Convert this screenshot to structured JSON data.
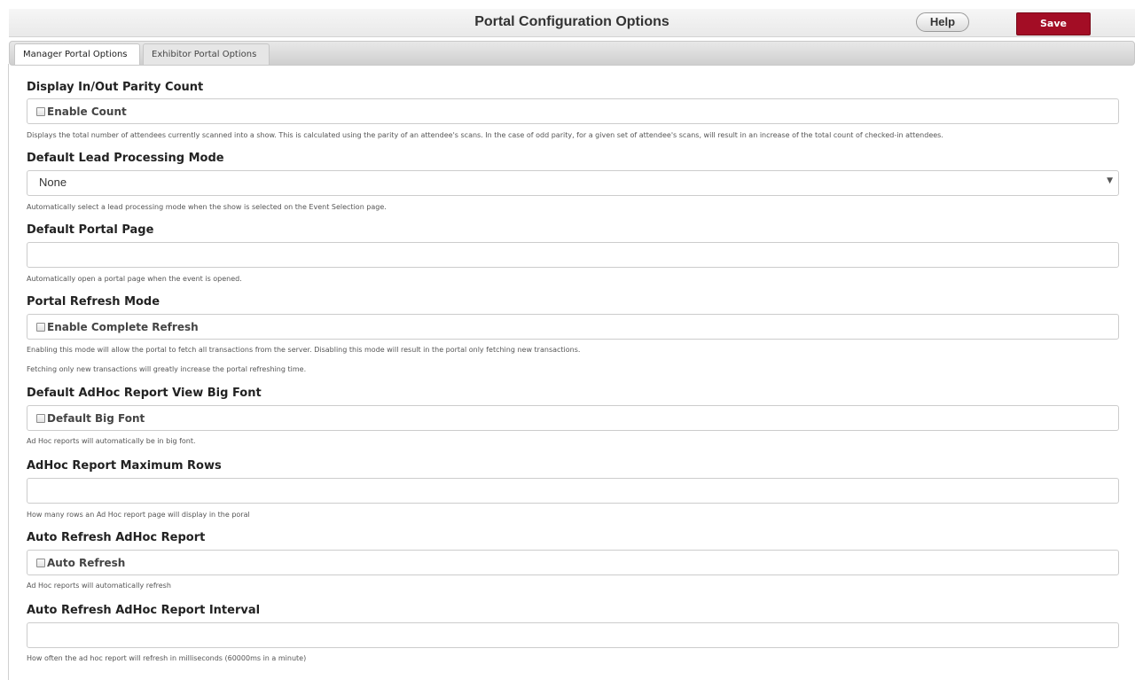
{
  "header": {
    "title": "Portal Configuration Options",
    "help_label": "Help",
    "save_label": "Save"
  },
  "tabs": [
    {
      "label": "Manager Portal Options",
      "active": true
    },
    {
      "label": "Exhibitor Portal Options",
      "active": false
    }
  ],
  "sections": [
    {
      "title": "Display In/Out Parity Count",
      "checkbox_label": "Enable Count",
      "checked": false,
      "description": "Displays the total number of attendees currently scanned into a show. This is calculated using the parity of an attendee's scans. In the case of odd parity, for a given set of attendee's scans, will result in an increase of the total count of checked-in attendees."
    },
    {
      "title": "Default Lead Processing Mode",
      "selected_value": "None",
      "description": "Automatically select a lead processing mode when the show is selected on the Event Selection page."
    },
    {
      "title": "Default Portal Page",
      "input_value": "",
      "description": "Automatically open a portal page when the event is opened."
    },
    {
      "title": "Portal Refresh Mode",
      "checkbox_label": "Enable Complete Refresh",
      "checked": false,
      "description": "Enabling this mode will allow the portal to fetch all transactions from the server. Disabling this mode will result in the portal only fetching new transactions.",
      "description2": "Fetching only new transactions will greatly increase the portal refreshing time."
    },
    {
      "title": "Default AdHoc Report View Big Font",
      "checkbox_label": "Default Big Font",
      "checked": false,
      "description": "Ad Hoc reports will automatically be in big font."
    },
    {
      "title": "AdHoc Report Maximum Rows",
      "input_value": "",
      "description": "How many rows an Ad Hoc report page will display in the poral"
    },
    {
      "title": "Auto Refresh AdHoc Report",
      "checkbox_label": "Auto Refresh",
      "checked": false,
      "description": "Ad Hoc reports will automatically refresh"
    },
    {
      "title": "Auto Refresh AdHoc Report Interval",
      "input_value": "",
      "description": "How often the ad hoc report will refresh in milliseconds (60000ms in a minute)"
    }
  ],
  "colors": {
    "save_button": "#a30d25",
    "header_bg": "#efefef",
    "border": "#cccccc"
  }
}
